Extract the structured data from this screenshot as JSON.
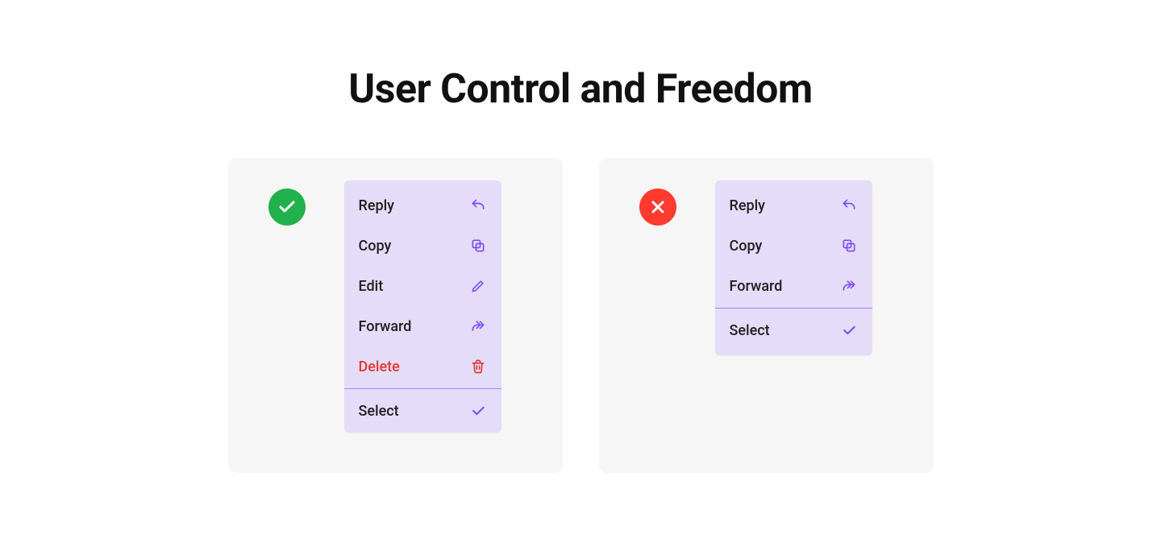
{
  "title": "User Control and Freedom",
  "colors": {
    "menu_bg": "#e5dcf9",
    "card_bg": "#f6f6f6",
    "icon_purple": "#7c4dff",
    "danger_red": "#e53935",
    "good_green": "#22b14c",
    "bad_red": "#ff3b30"
  },
  "good_example": {
    "badge": "good",
    "menu_items": [
      {
        "key": "reply",
        "label": "Reply",
        "icon": "reply-icon",
        "danger": false
      },
      {
        "key": "copy",
        "label": "Copy",
        "icon": "copy-icon",
        "danger": false
      },
      {
        "key": "edit",
        "label": "Edit",
        "icon": "edit-icon",
        "danger": false
      },
      {
        "key": "forward",
        "label": "Forward",
        "icon": "forward-icon",
        "danger": false
      },
      {
        "key": "delete",
        "label": "Delete",
        "icon": "delete-icon",
        "danger": true
      }
    ],
    "menu_items_after_sep": [
      {
        "key": "select",
        "label": "Select",
        "icon": "check-icon",
        "danger": false
      }
    ]
  },
  "bad_example": {
    "badge": "bad",
    "menu_items": [
      {
        "key": "reply",
        "label": "Reply",
        "icon": "reply-icon",
        "danger": false
      },
      {
        "key": "copy",
        "label": "Copy",
        "icon": "copy-icon",
        "danger": false
      },
      {
        "key": "forward",
        "label": "Forward",
        "icon": "forward-icon",
        "danger": false
      }
    ],
    "menu_items_after_sep": [
      {
        "key": "select",
        "label": "Select",
        "icon": "check-icon",
        "danger": false
      }
    ]
  }
}
